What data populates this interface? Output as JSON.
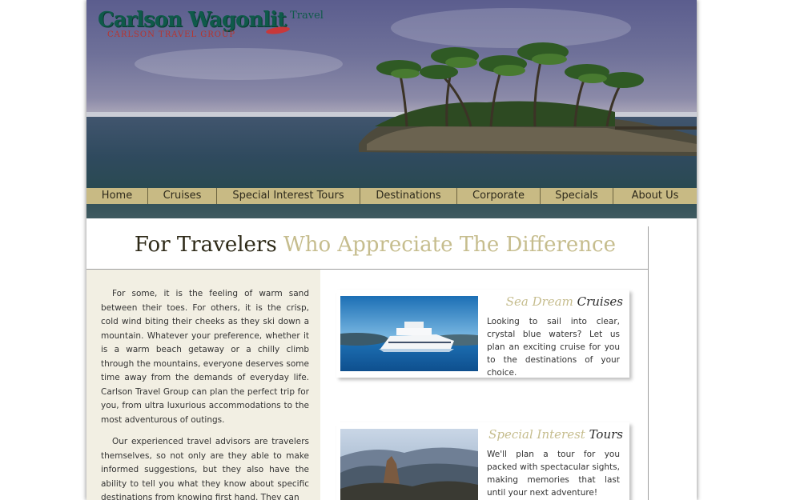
{
  "brand": {
    "name": "Carlson Wagonlit",
    "super": "Travel",
    "sub": "CARLSON TRAVEL GROUP"
  },
  "nav": [
    {
      "label": "Home"
    },
    {
      "label": "Cruises"
    },
    {
      "label": "Special Interest Tours"
    },
    {
      "label": "Destinations"
    },
    {
      "label": "Corporate"
    },
    {
      "label": "Specials"
    },
    {
      "label": "About Us"
    }
  ],
  "headline": {
    "dark": "For Travelers",
    "light": "Who Appreciate The Difference"
  },
  "intro": {
    "p1": "For some, it is the feeling of warm sand between their toes. For others, it is the crisp, cold wind biting their cheeks as they ski down a mountain. Whatever your preference, whether it is a warm beach getaway or a chilly climb through the mountains, everyone deserves some time away from the demands of everyday life. Carlson Travel Group can plan the perfect trip for you, from ultra luxurious accommodations to the most adventurous of outings.",
    "p2": "Our experienced travel advisors are travelers themselves, so not only are they able to make informed suggestions, but they also have the ability to tell you what they know about specific destinations from knowing first hand. They can"
  },
  "cards": {
    "cruises": {
      "title_light": "Sea Dream",
      "title_dark": "Cruises",
      "text": "Looking to sail into clear, crystal blue waters? Let us plan an exciting cruise for you to the destinations of your choice."
    },
    "tours": {
      "title_light": "Special Interest",
      "title_dark": "Tours",
      "text": "We'll plan a tour for you packed with spectacular sights, making memories that last until your next adventure!"
    }
  },
  "colors": {
    "nav_bg": "#c8ba84",
    "headline_light": "#c6bd8e",
    "left_bg": "#f2efe3",
    "logo_green": "#0f5a4a",
    "logo_red": "#b8342e"
  }
}
